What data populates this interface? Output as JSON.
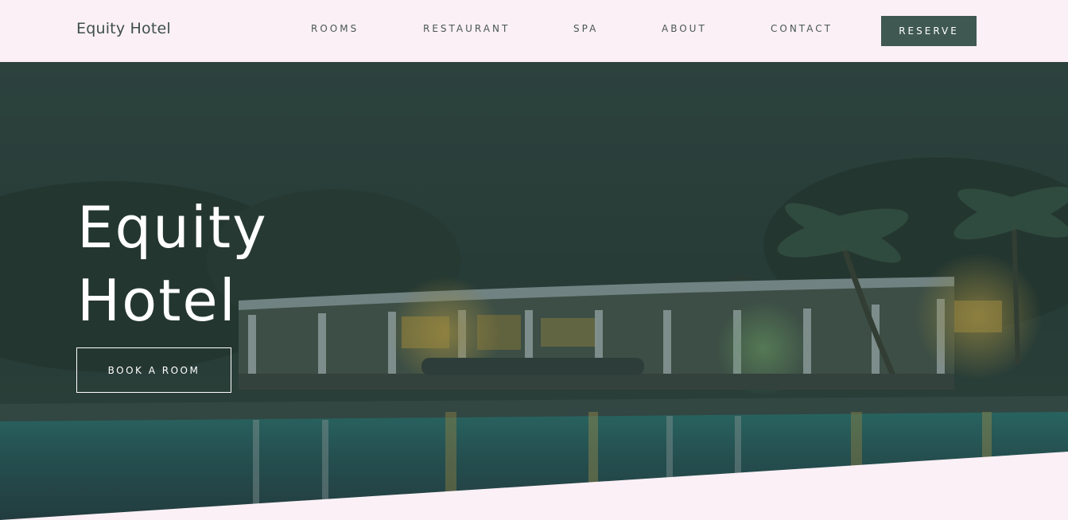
{
  "header": {
    "brand": "Equity Hotel",
    "nav": [
      {
        "label": "ROOMS"
      },
      {
        "label": "RESTAURANT"
      },
      {
        "label": "SPA"
      },
      {
        "label": "ABOUT"
      },
      {
        "label": "CONTACT"
      }
    ],
    "reserve_label": "RESERVE"
  },
  "hero": {
    "title_line1": "Equity",
    "title_line2": "Hotel",
    "cta_label": "BOOK A ROOM"
  },
  "colors": {
    "background": "#fbf0f5",
    "accent": "#3f5852",
    "text_dark": "#3e4f4b"
  }
}
